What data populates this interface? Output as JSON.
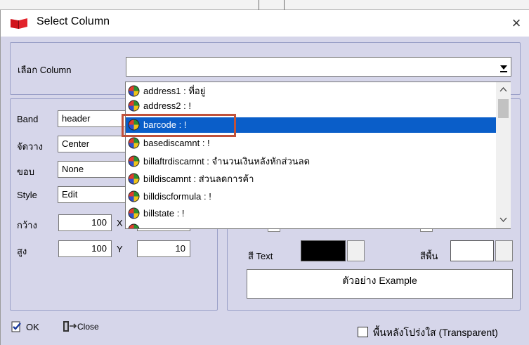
{
  "dialog": {
    "title": "Select Column",
    "close_symbol": "×"
  },
  "select_column": {
    "label": "เลือก Column",
    "value": ""
  },
  "dropdown": {
    "items": [
      {
        "text": "address1 :  ที่อยู่",
        "selected": false
      },
      {
        "text": "address2 : !",
        "selected": false
      },
      {
        "text": "barcode : !",
        "selected": true
      },
      {
        "text": "basediscamnt : !",
        "selected": false
      },
      {
        "text": "billaftrdiscamnt : จำนวนเงินหลังหักส่วนลด",
        "selected": false
      },
      {
        "text": "billdiscamnt : ส่วนลดการค้า",
        "selected": false
      },
      {
        "text": "billdiscformula : !",
        "selected": false
      },
      {
        "text": "billstate : !",
        "selected": false
      }
    ]
  },
  "props": {
    "band_label": "Band",
    "band_value": "header",
    "align_label": "จัดวาง",
    "align_value": "Center",
    "border_label": "ขอบ",
    "border_value": "None",
    "style_label": "Style",
    "style_value": "Edit",
    "width_label": "กว้าง",
    "width_value": "100",
    "x_label": "X",
    "height_label": "สูง",
    "height_value": "100",
    "y_label": "Y",
    "y_value": "10"
  },
  "colors": {
    "text_label": "สี Text",
    "bg_label": "สีพื้น",
    "text_color": "#000000",
    "bg_color": "#ffffff",
    "example": "ตัวอย่าง Example"
  },
  "footer": {
    "ok_label": "OK",
    "close_label": "Close",
    "transparent_label": "พื้นหลังโปร่งใส (Transparent)"
  },
  "accent": {
    "selection": "#0a5ec9",
    "highlight_border": "#c0523b"
  }
}
